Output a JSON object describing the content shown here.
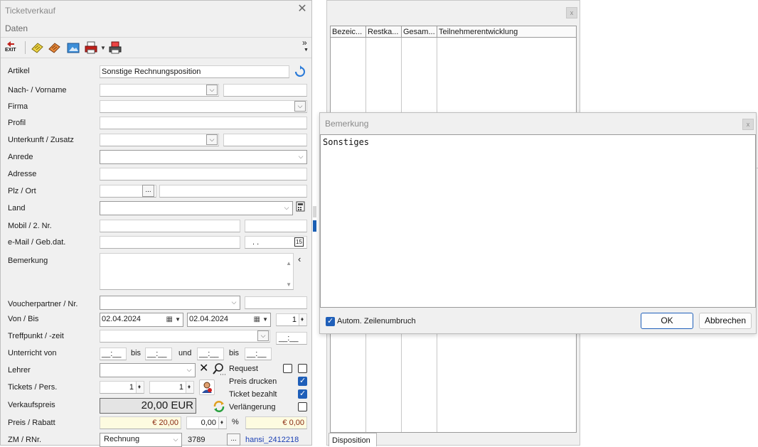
{
  "background_window": {
    "close_glyph": "x",
    "grid_columns": [
      "Bezeic...",
      "Restka...",
      "Gesam...",
      "Teilnehmerentwicklung"
    ],
    "tab_label": "Disposition"
  },
  "main_window": {
    "title": "Ticketverkauf",
    "close_glyph": "✕",
    "menu": {
      "daten": "Daten"
    },
    "toolbar": {
      "exit_label": "EXIT",
      "overflow_glyph": "»"
    },
    "labels": {
      "artikel": "Artikel",
      "name": "Nach- / Vorname",
      "firma": "Firma",
      "profil": "Profil",
      "unterkunft": "Unterkunft / Zusatz",
      "anrede": "Anrede",
      "adresse": "Adresse",
      "plz_ort": "Plz / Ort",
      "land": "Land",
      "mobil": "Mobil / 2. Nr.",
      "email": "e-Mail / Geb.dat.",
      "bemerkung": "Bemerkung",
      "voucher": "Voucherpartner / Nr.",
      "von_bis": "Von / Bis",
      "treffpunkt": "Treffpunkt / -zeit",
      "unterricht": "Unterricht von",
      "lehrer": "Lehrer",
      "tickets": "Tickets / Pers.",
      "verkaufspreis": "Verkaufspreis",
      "preis_rabatt": "Preis / Rabatt",
      "zm_rnr": "ZM / RNr."
    },
    "values": {
      "artikel": "Sonstige Rechnungsposition",
      "plz_button": "...",
      "geb_dat": ". .",
      "von_date": "02.04.2024",
      "bis_date": "02.04.2024",
      "days": "1",
      "treffpunkt_time": "__:__",
      "unterricht_von_1": "__:__",
      "bis_1": "bis",
      "unterricht_von_2": "__:__",
      "und": "und",
      "unterricht_von_3": "__:__",
      "bis_2": "bis",
      "unterricht_von_4": "__:__",
      "tickets": "1",
      "persons": "1",
      "verkaufspreis": "20,00 EUR",
      "preis": "€ 20,00",
      "rabatt": "0,00",
      "percent": "%",
      "rabatt_amount": "€ 0,00",
      "zm": "Rechnung",
      "rnr": "3789",
      "rnr_button": "...",
      "user": "hansi_2412218"
    },
    "options": {
      "request": {
        "label": "Request",
        "checked": false
      },
      "preis_drucken": {
        "label": "Preis drucken",
        "checked": true
      },
      "ticket_bezahlt": {
        "label": "Ticket bezahlt",
        "checked": true
      },
      "verlaengerung": {
        "label": "Verlängerung",
        "checked": false
      }
    },
    "colors": {
      "highlight_field": "#fdfbe0",
      "accent": "#1f5fb9",
      "user_link": "#1a3fb4"
    }
  },
  "dialog": {
    "title": "Bemerkung",
    "close_glyph": "x",
    "text": "Sonstiges",
    "wrap_label": "Autom. Zeilenumbruch",
    "wrap_checked": true,
    "ok_label": "OK",
    "cancel_label": "Abbrechen"
  }
}
